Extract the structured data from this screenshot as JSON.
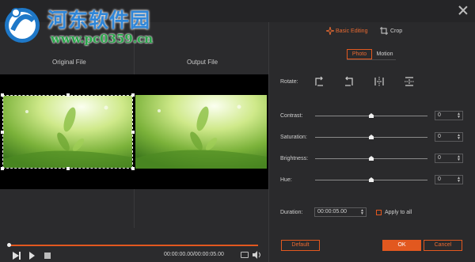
{
  "watermark": {
    "title": "河东软件园",
    "url": "www.pc0359.cn"
  },
  "preview": {
    "original_label": "Original File",
    "output_label": "Output File"
  },
  "playback": {
    "timecode": "00:00:00.00/00:00:05.00",
    "progress": 0.0
  },
  "editor": {
    "tabs": [
      {
        "label": "Basic Editing",
        "active": true,
        "icon": "sparkle-icon"
      },
      {
        "label": "Crop",
        "active": false,
        "icon": "crop-icon"
      }
    ],
    "subtabs": [
      {
        "label": "Photo",
        "active": true
      },
      {
        "label": "Motion",
        "active": false
      }
    ],
    "rotate_label": "Rotate:",
    "rotate_icons": [
      "rotate-right-icon",
      "rotate-left-icon",
      "flip-horizontal-icon",
      "flip-vertical-icon"
    ],
    "adjustments": [
      {
        "label": "Contrast:",
        "value": "0",
        "level": 0.5
      },
      {
        "label": "Saturation:",
        "value": "0",
        "level": 0.5
      },
      {
        "label": "Brightness:",
        "value": "0",
        "level": 0.5
      },
      {
        "label": "Hue:",
        "value": "0",
        "level": 0.5
      }
    ],
    "duration_label": "Duration:",
    "duration_value": "00:00:05.00",
    "apply_all_label": "Apply to all",
    "apply_all_checked": false
  },
  "buttons": {
    "default": "Default",
    "ok": "OK",
    "cancel": "Cancel"
  },
  "colors": {
    "accent": "#e2581f",
    "background": "#2b2b2d",
    "watermark_title": "#2f86d8",
    "watermark_url": "#2aa64a"
  }
}
